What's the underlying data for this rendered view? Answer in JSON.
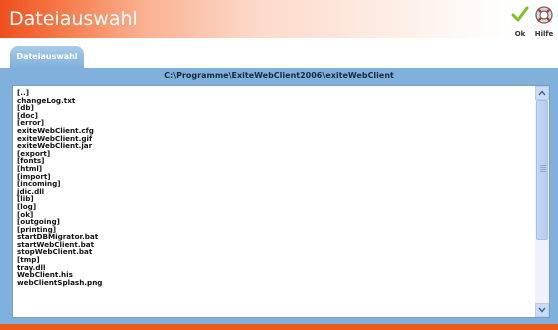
{
  "window": {
    "title": "Dateiauswahl"
  },
  "toolbar": {
    "ok_label": "Ok",
    "help_label": "Hilfe"
  },
  "tabs": [
    {
      "label": "Dateiauswahl"
    }
  ],
  "path": "C:\\Programme\\ExiteWebClient2006\\exiteWebClient",
  "files": [
    "[..]",
    "changeLog.txt",
    "[db]",
    "[doc]",
    "[error]",
    "exiteWebClient.cfg",
    "exiteWebClient.gif",
    "exiteWebClient.jar",
    "[export]",
    "[fonts]",
    "[html]",
    "[import]",
    "[incoming]",
    "jdic.dll",
    "[lib]",
    "[log]",
    "[ok]",
    "[outgoing]",
    "[printing]",
    "startDBMigrator.bat",
    "startWebClient.bat",
    "stopWebClient.bat",
    "[tmp]",
    "tray.dll",
    "WebClient.his",
    "webClientSplash.png"
  ],
  "colors": {
    "title_gradient_start": "#ee4f1e",
    "panel_blue": "#7fb1dc",
    "bottom_bar": "#ee5a1e",
    "ok_check": "#7dc21e"
  },
  "icons": {
    "ok": "checkmark-icon",
    "help": "help-lifebuoy-icon"
  }
}
